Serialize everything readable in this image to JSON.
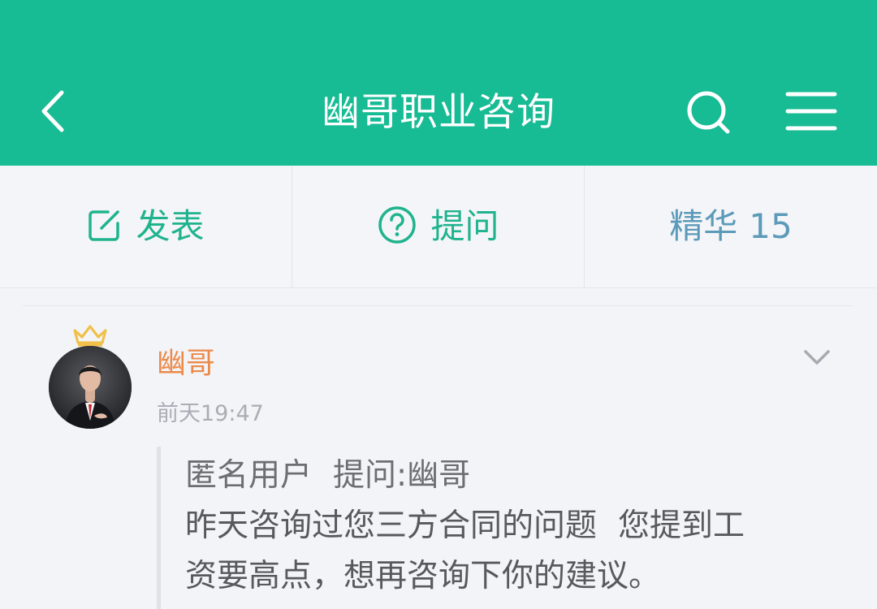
{
  "header": {
    "title": "幽哥职业咨询",
    "back_icon": "chevron-left-icon",
    "search_icon": "search-icon",
    "menu_icon": "hamburger-menu-icon",
    "background_color": "#17bb94"
  },
  "actions": {
    "post": {
      "label": "发表",
      "icon": "edit-icon"
    },
    "ask": {
      "label": "提问",
      "icon": "question-circle-icon"
    },
    "featured": {
      "label": "精华",
      "count": "15"
    }
  },
  "post": {
    "author": "幽哥",
    "badge_icon": "crown-icon",
    "time": "前天19:47",
    "more_icon": "chevron-down-icon",
    "quote": {
      "asker": "匿名用户",
      "ask_label": "提问:",
      "target": "幽哥",
      "line2a": "昨天咨询过您三方合同的问题",
      "line2b": "您提到工",
      "line3": "资要高点，想再咨询下你的建议。"
    }
  },
  "colors": {
    "accent": "#17bb94",
    "action_text": "#1fb38e",
    "featured_text": "#5c9ab9",
    "author_name": "#ec8a4a",
    "crown": "#f0c04a"
  }
}
